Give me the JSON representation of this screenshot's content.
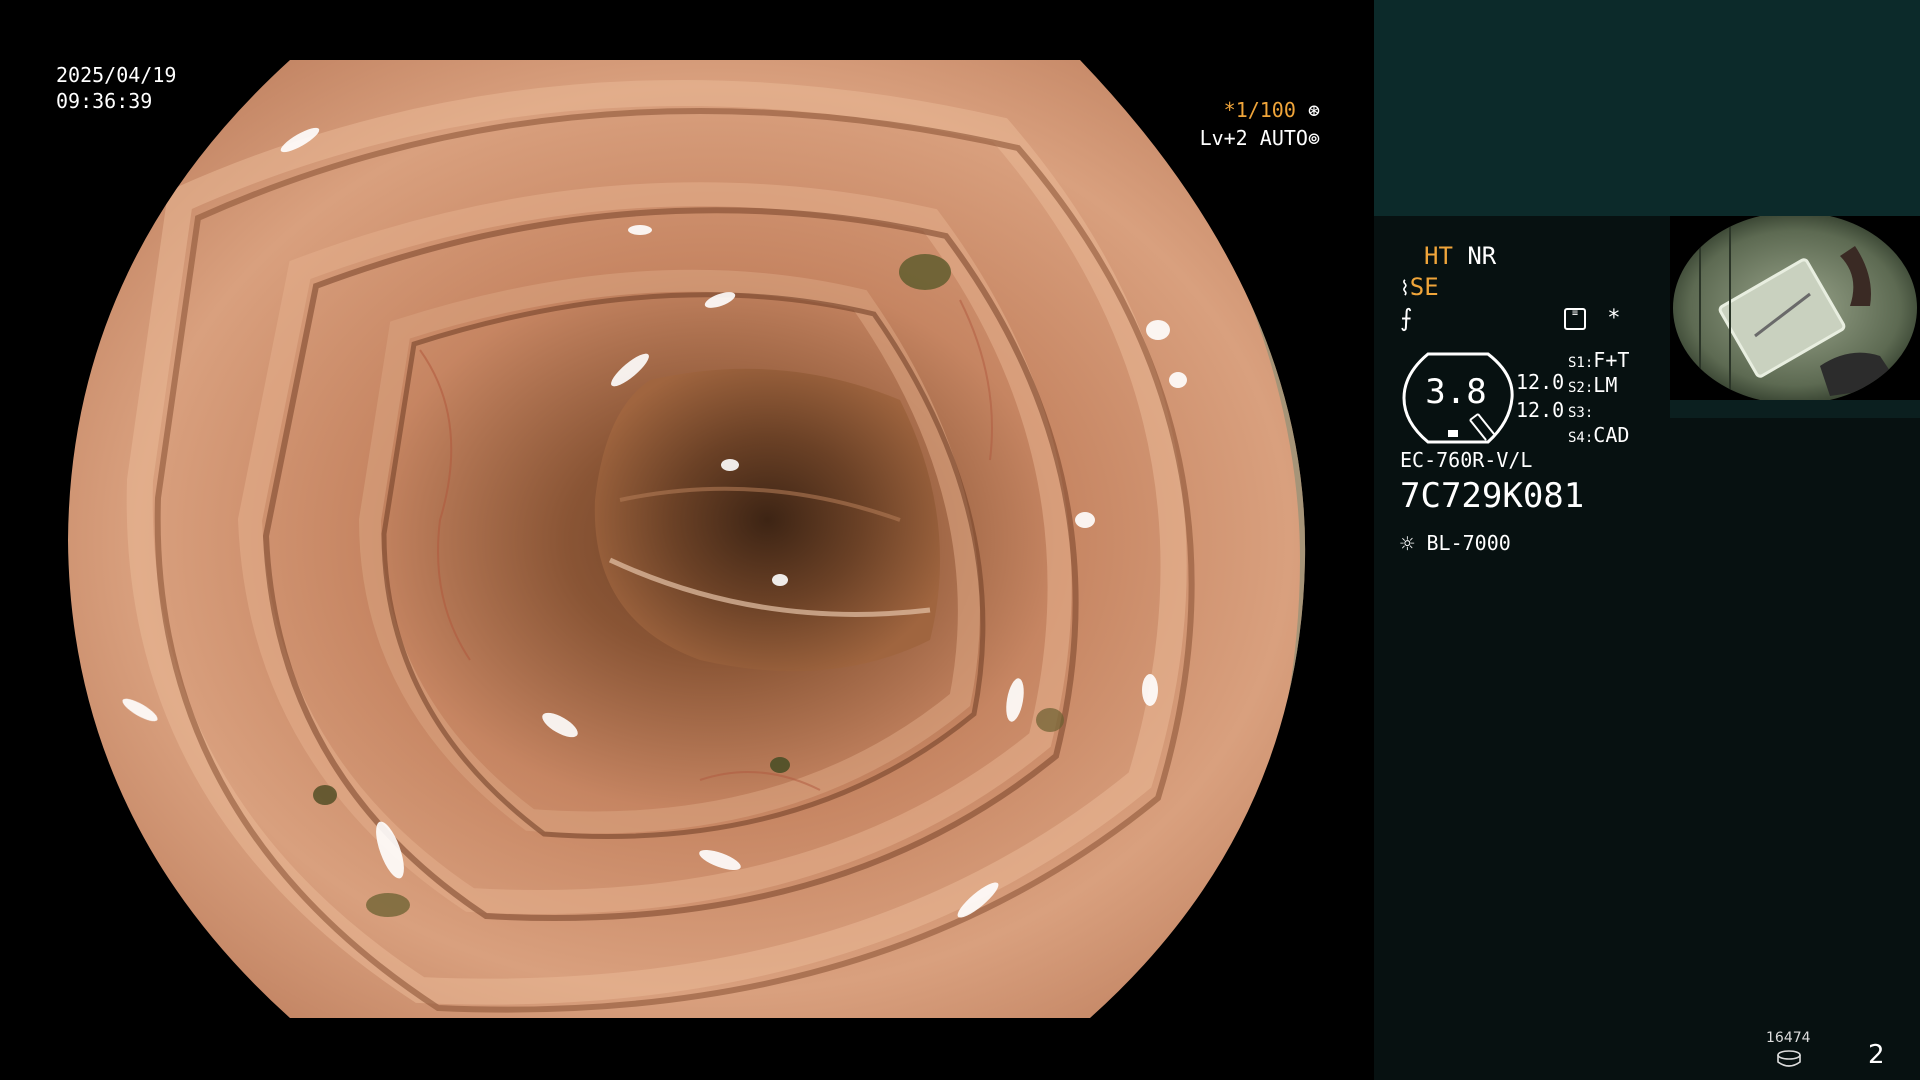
{
  "overlay": {
    "date": "2025/04/19",
    "time": "09:36:39",
    "shutter_prefix": "*",
    "shutter": "1/100",
    "shutter_icon": "aperture-icon",
    "level": "Lv+2",
    "exposure_mode": "AUTO",
    "exposure_icon": "iris-icon"
  },
  "panel": {
    "ht": "HT",
    "nr": "NR",
    "se": "SE",
    "se_icon": "structure-enhance-icon",
    "enh_icon": "color-enhance-icon",
    "settings_icon": "menu-settings-icon",
    "star": "*",
    "gauge_value": "3.8",
    "value_a": "12.0",
    "value_b": "12.0",
    "switches": [
      {
        "key": "S1",
        "value": "F+T"
      },
      {
        "key": "S2",
        "value": "LM"
      },
      {
        "key": "S3",
        "value": ""
      },
      {
        "key": "S4",
        "value": "CAD"
      }
    ],
    "scope_model": "EC-760R-V/L",
    "scope_serial": "7C729K081",
    "light_icon": "lamp-icon",
    "light_source": "BL-7000"
  },
  "footer": {
    "counter": "16474",
    "counter_icon": "disk-icon",
    "page": "2"
  },
  "colors": {
    "accent": "#f0a53a",
    "panel_bg": "#071111",
    "panel_top": "#0c2a2a",
    "mucosa": "#c98a68"
  }
}
